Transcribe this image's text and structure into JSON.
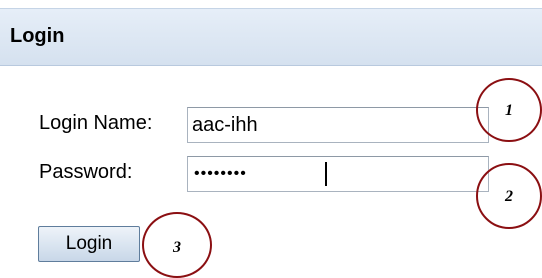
{
  "header": {
    "title": "Login"
  },
  "form": {
    "login_name_label": "Login Name:",
    "login_name_value": "aac-ihh",
    "password_label": "Password:",
    "password_masked": "••••••••",
    "submit_label": "Login"
  },
  "callouts": [
    "1",
    "2",
    "3"
  ],
  "colors": {
    "header_bg": "#dfe8f3",
    "callout_border": "#8b0f12",
    "button_border": "#5f7d9c"
  }
}
